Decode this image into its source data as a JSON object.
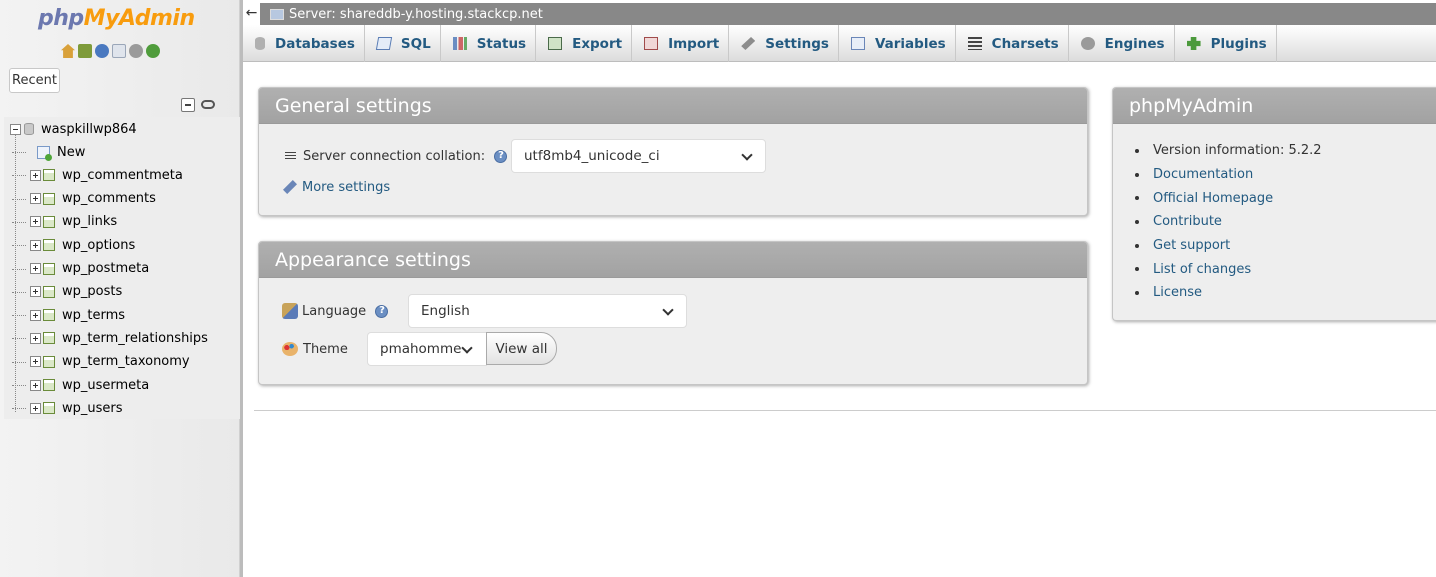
{
  "app": {
    "logo_php": "php",
    "logo_myadmin": "MyAdmin"
  },
  "nav": {
    "recent_label": "Recent",
    "database": "waspkillwp864",
    "new_label": "New",
    "tables": [
      "wp_commentmeta",
      "wp_comments",
      "wp_links",
      "wp_options",
      "wp_postmeta",
      "wp_posts",
      "wp_terms",
      "wp_term_relationships",
      "wp_term_taxonomy",
      "wp_usermeta",
      "wp_users"
    ],
    "icons": [
      "home-icon",
      "logout-icon",
      "help-icon",
      "docs-icon",
      "settings-icon",
      "reload-icon"
    ]
  },
  "serverbar": {
    "back": "←",
    "server": "Server: shareddb-y.hosting.stackcp.net"
  },
  "tabs": [
    {
      "label": "Databases",
      "icon": "databases-icon"
    },
    {
      "label": "SQL",
      "icon": "sql-icon"
    },
    {
      "label": "Status",
      "icon": "status-icon"
    },
    {
      "label": "Export",
      "icon": "export-icon"
    },
    {
      "label": "Import",
      "icon": "import-icon"
    },
    {
      "label": "Settings",
      "icon": "settings-icon"
    },
    {
      "label": "Variables",
      "icon": "variables-icon"
    },
    {
      "label": "Charsets",
      "icon": "charsets-icon"
    },
    {
      "label": "Engines",
      "icon": "engines-icon"
    },
    {
      "label": "Plugins",
      "icon": "plugins-icon"
    }
  ],
  "general": {
    "title": "General settings",
    "collation_label": "Server connection collation:",
    "collation_value": "utf8mb4_unicode_ci",
    "more_settings": "More settings"
  },
  "appearance": {
    "title": "Appearance settings",
    "language_label": "Language",
    "language_value": "English",
    "theme_label": "Theme",
    "theme_value": "pmahomme",
    "view_all": "View all"
  },
  "info": {
    "title": "phpMyAdmin",
    "version": "Version information: 5.2.2",
    "links": [
      "Documentation",
      "Official Homepage",
      "Contribute",
      "Get support",
      "List of changes",
      "License"
    ]
  },
  "colors": {
    "link": "#235a81",
    "panel_header": "#a8a8a8",
    "serverbar": "#888888"
  }
}
